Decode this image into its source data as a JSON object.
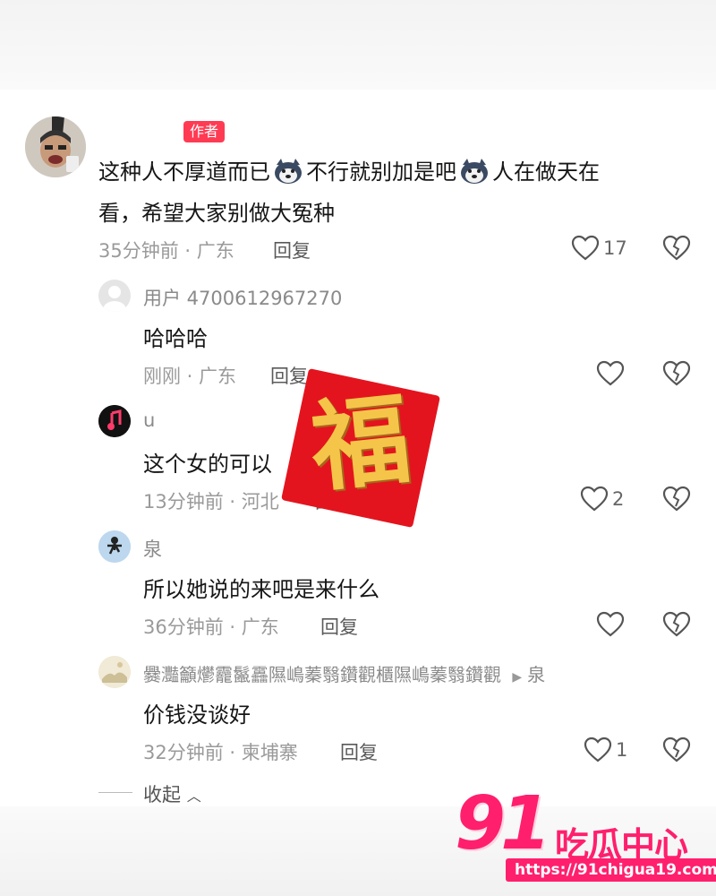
{
  "comments": [
    {
      "username": "",
      "badge": "作者",
      "text_part1": "这种人不厚道而已",
      "text_part2": "不行就别加是吧",
      "text_part3": "人在做天在",
      "text_line2": "看，希望大家别做大冤种",
      "meta": "35分钟前 · 广东",
      "reply_label": "回复",
      "likes": "17",
      "emoji_icon": "husky-dog-emoji"
    },
    {
      "username": "用户 4700612967270",
      "text": "哈哈哈",
      "meta": "刚刚 · 广东",
      "reply_label": "回复",
      "likes": ""
    },
    {
      "username": "u",
      "text": "这个女的可以",
      "meta": "13分钟前 · 河北",
      "reply_label": "回复",
      "likes": "2"
    },
    {
      "username": "泉",
      "text": "所以她说的来吧是来什么",
      "meta": "36分钟前 · 广东",
      "reply_label": "回复",
      "likes": ""
    },
    {
      "username": "爨灩籲爩龗鬣靐隰嶋蓁翳鑽觀櫃隰嶋蓁翳鑽觀",
      "reply_to": "泉",
      "text": "价钱没谈好",
      "meta": "32分钟前 · 柬埔寨",
      "reply_label": "回复",
      "likes": "1"
    }
  ],
  "collapse_label": "收起",
  "stamp_char": "福",
  "watermark": {
    "number": "91",
    "name": "吃瓜中心",
    "url": "https://91chigua19.com"
  },
  "colors": {
    "badge": "#ff3b54",
    "watermark": "#ff1f6d",
    "stamp_red": "#e4141e",
    "stamp_gold": "#f5c54a"
  }
}
